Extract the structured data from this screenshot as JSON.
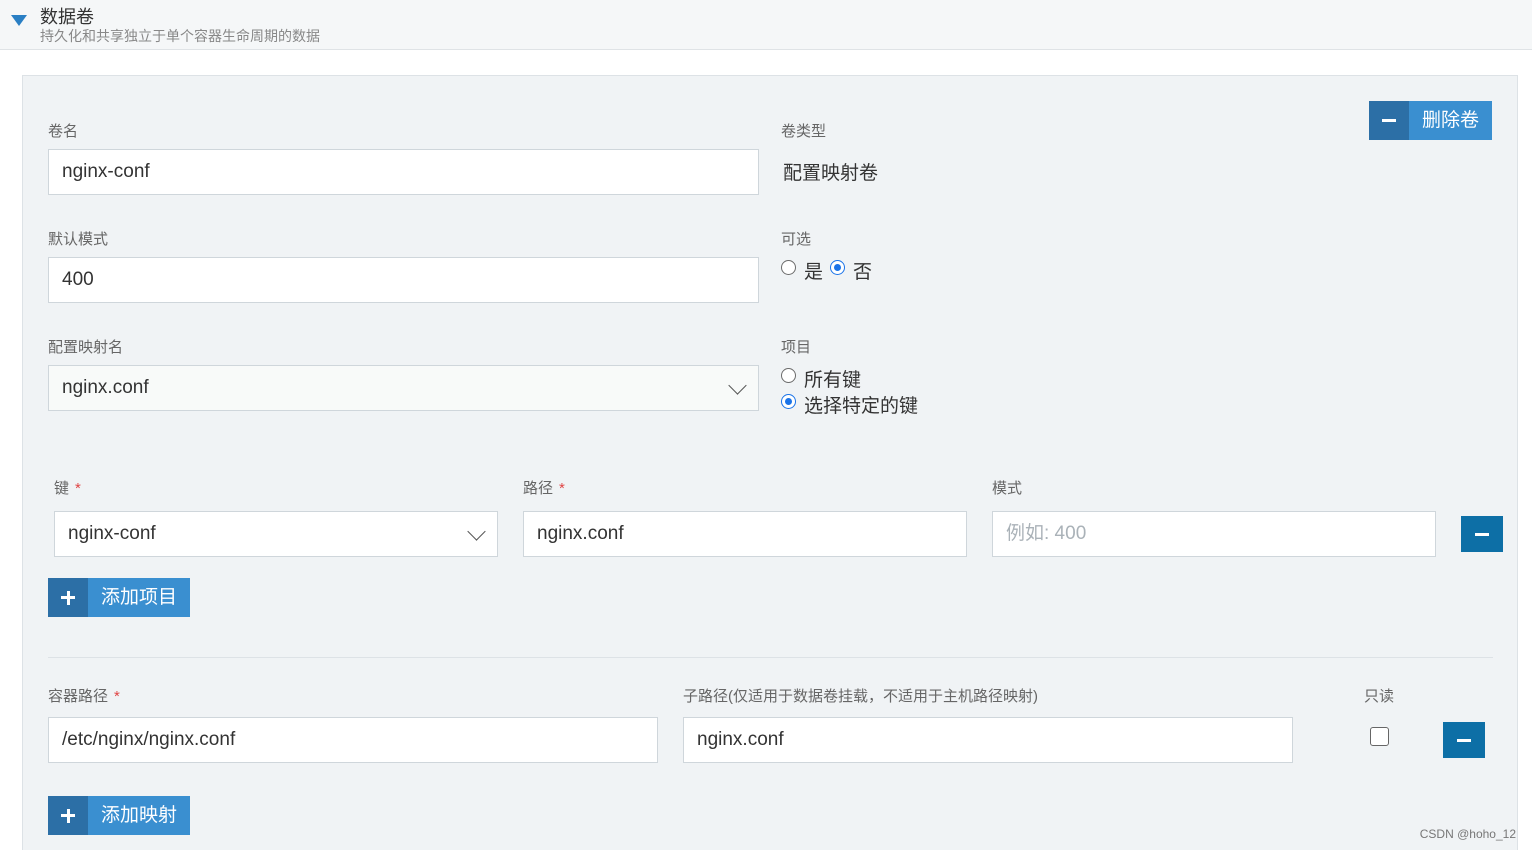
{
  "section": {
    "title": "数据卷",
    "subtitle": "持久化和共享独立于单个容器生命周期的数据"
  },
  "volume": {
    "name_label": "卷名",
    "name_value": "nginx-conf",
    "type_label": "卷类型",
    "type_value": "配置映射卷",
    "delete_label": "删除卷",
    "default_mode_label": "默认模式",
    "default_mode_value": "400",
    "optional_label": "可选",
    "optional_yes": "是",
    "optional_no": "否",
    "optional_selected": "否",
    "configmap_label": "配置映射名",
    "configmap_value": "nginx.conf",
    "items_label": "项目",
    "items_all_keys": "所有键",
    "items_specific_keys": "选择特定的键",
    "items_selected": "选择特定的键"
  },
  "key_item": {
    "key_label": "键",
    "key_value": "nginx-conf",
    "path_label": "路径",
    "path_value": "nginx.conf",
    "mode_label": "模式",
    "mode_placeholder": "例如: 400",
    "required_mark": "*",
    "add_item_label": "添加项目"
  },
  "mount": {
    "container_path_label": "容器路径",
    "container_path_value": "/etc/nginx/nginx.conf",
    "subpath_label": "子路径(仅适用于数据卷挂载，不适用于主机路径映射)",
    "subpath_value": "nginx.conf",
    "readonly_label": "只读",
    "readonly_checked": false,
    "add_mapping_label": "添加映射"
  },
  "watermark": "CSDN @hoho_12",
  "colors": {
    "accent": "#3a8fd0",
    "accent_dark": "#2c6fa6",
    "minus_button": "#0d6fa6",
    "radio_selected": "#1a73e8",
    "required": "#e04444"
  }
}
